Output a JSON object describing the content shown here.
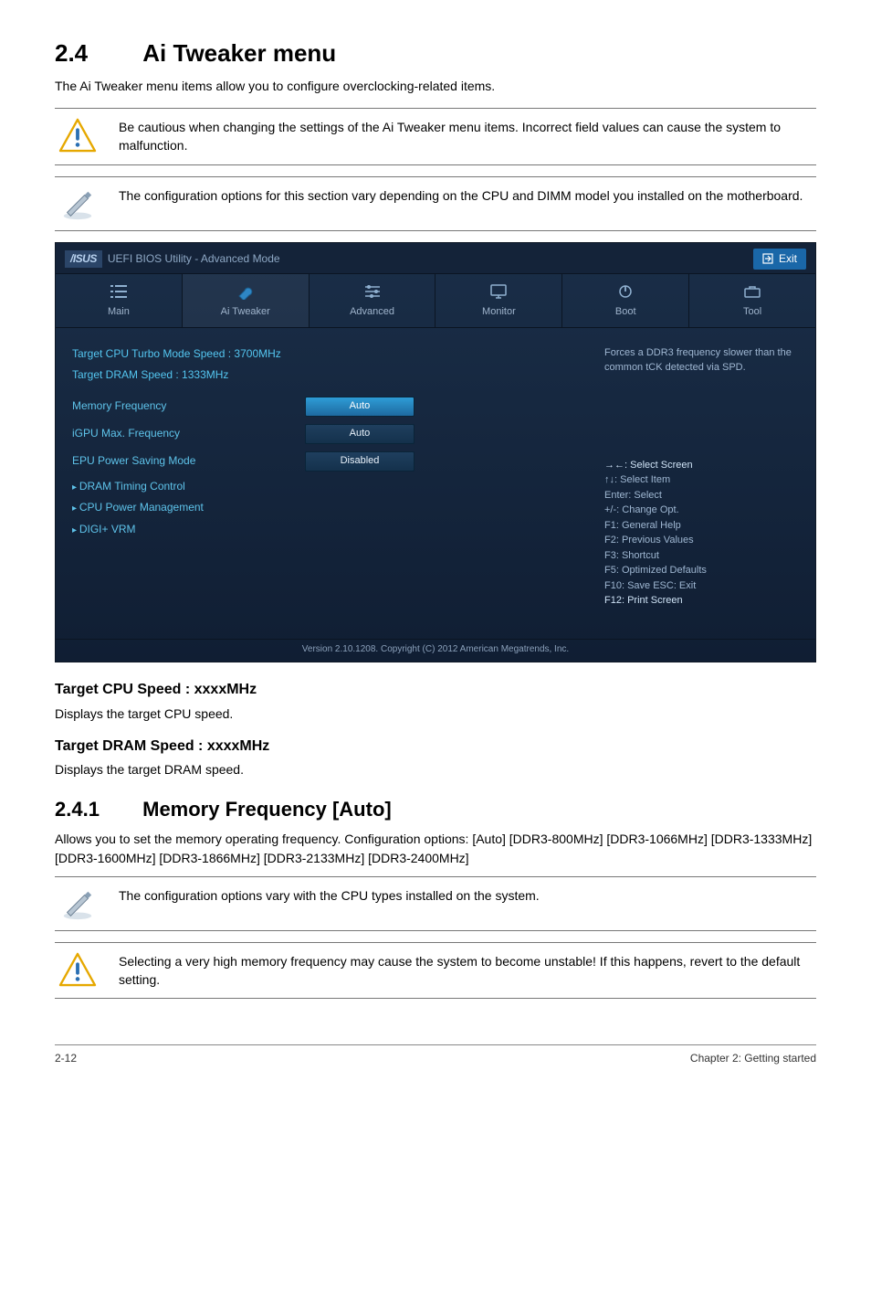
{
  "section": {
    "number": "2.4",
    "title": "Ai Tweaker menu",
    "intro": "The Ai Tweaker menu items allow you to configure overclocking-related items."
  },
  "note_caution": "Be cautious when changing the settings of the Ai Tweaker menu items. Incorrect field values can cause the system to malfunction.",
  "note_config": "The configuration options for this section vary depending on the CPU and DIMM model you installed on the motherboard.",
  "bios": {
    "brand_suffix": "UEFI BIOS Utility - Advanced Mode",
    "exit_label": "Exit",
    "tabs": {
      "main": "Main",
      "ai": "Ai Tweaker",
      "advanced": "Advanced",
      "monitor": "Monitor",
      "boot": "Boot",
      "tool": "Tool"
    },
    "targets": {
      "cpu": "Target CPU Turbo Mode Speed : 3700MHz",
      "dram": "Target DRAM Speed : 1333MHz"
    },
    "rows": {
      "mem_freq_label": "Memory Frequency",
      "mem_freq_val": "Auto",
      "icpu_label": "iGPU Max. Frequency",
      "icpu_val": "Auto",
      "epu_label": "EPU Power Saving Mode",
      "epu_val": "Disabled"
    },
    "subs": {
      "dram_timing": "DRAM Timing Control",
      "cpu_power": "CPU Power Management",
      "digi": "DIGI+ VRM"
    },
    "right_hint": "Forces a DDR3 frequency slower than the common tCK detected via SPD.",
    "keys": {
      "a": "→←: Select Screen",
      "b": "↑↓: Select Item",
      "c": "Enter: Select",
      "d": "+/-: Change Opt.",
      "e": "F1: General Help",
      "f": "F2: Previous Values",
      "g": "F3: Shortcut",
      "h": "F5: Optimized Defaults",
      "i": "F10: Save   ESC: Exit",
      "j": "F12: Print Screen"
    },
    "footer": "Version 2.10.1208. Copyright (C) 2012 American Megatrends, Inc."
  },
  "target_cpu": {
    "head": "Target CPU Speed : xxxxMHz",
    "body": "Displays the target CPU speed."
  },
  "target_dram": {
    "head": "Target DRAM Speed : xxxxMHz",
    "body": "Displays the target DRAM speed."
  },
  "subsection": {
    "number": "2.4.1",
    "title": "Memory Frequency [Auto]",
    "body": "Allows you to set the memory operating frequency. Configuration options: [Auto] [DDR3-800MHz] [DDR3-1066MHz] [DDR3-1333MHz] [DDR3-1600MHz] [DDR3-1866MHz] [DDR3-2133MHz] [DDR3-2400MHz]"
  },
  "note_cpu_types": "The configuration options vary with the CPU types installed on the system.",
  "note_unstable": "Selecting a very high memory frequency may cause the system to become unstable! If this happens, revert to the default setting.",
  "footer": {
    "page": "2-12",
    "chapter": "Chapter 2: Getting started"
  }
}
